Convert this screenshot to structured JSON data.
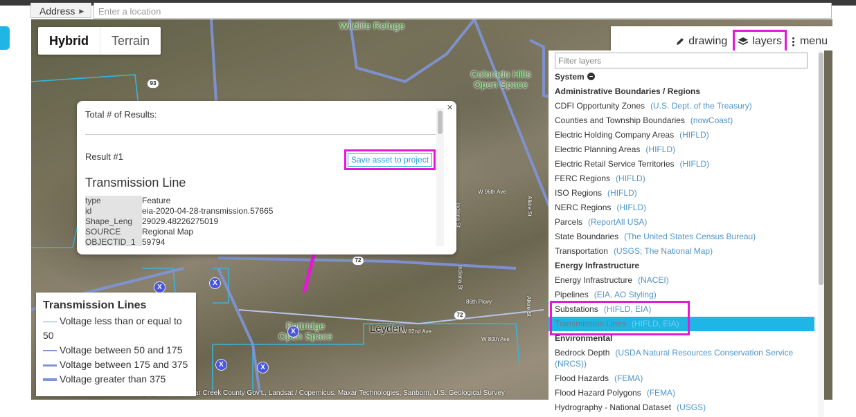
{
  "address": {
    "label": "Address",
    "placeholder": "Enter a location"
  },
  "map": {
    "type_options": [
      "Hybrid",
      "Terrain"
    ],
    "active_type": "Hybrid",
    "labels": {
      "wildlife_refuge": "Wildlife Refuge",
      "colorado_hills": "Colorado Hills Open Space",
      "pattridge": "Pattridge Open Space",
      "leyden": "Leyden"
    },
    "roads": {
      "w96": "W 96th Ave",
      "w86": "86th Pkwy",
      "w82": "W 82nd Ave",
      "w80": "W 80th Ave",
      "indiana": "Indiana St",
      "alkire": "Alkire St",
      "shield_93": "93",
      "shield_72": "72",
      "shield_72b": "72"
    },
    "attribution": "Imagery ©2020 , Clear Creek County Gov't., Landsat / Copernicus, Maxar Technologies, Sanborn, U.S. Geological Survey"
  },
  "popup": {
    "total_label": "Total # of Results:",
    "result_label": "Result #1",
    "save_button": "Save asset to project",
    "feature_title": "Transmission Line",
    "attributes": [
      {
        "key": "type",
        "value": "Feature"
      },
      {
        "key": "id",
        "value": "eia-2020-04-28-transmission.57665"
      },
      {
        "key": "Shape_Leng",
        "value": "29029.48226275019"
      },
      {
        "key": "SOURCE",
        "value": "Regional Map"
      },
      {
        "key": "OBJECTID_1",
        "value": "59794"
      }
    ],
    "close_glyph": "×"
  },
  "legend": {
    "title": "Transmission Lines",
    "items": [
      {
        "label": "Voltage less than or equal to 50",
        "weight": 1
      },
      {
        "label": "Voltage between 50 and 175",
        "weight": 2
      },
      {
        "label": "Voltage between 175 and 375",
        "weight": 3
      },
      {
        "label": "Voltage greater than 375",
        "weight": 4
      }
    ]
  },
  "toolbar": {
    "drawing": "drawing",
    "layers": "layers",
    "menu": "menu"
  },
  "layers": {
    "filter_placeholder": "Filter layers",
    "system_label": "System",
    "groups": [
      {
        "name": "Administrative Boundaries / Regions",
        "items": [
          {
            "name": "CDFI Opportunity Zones",
            "source": "(U.S. Dept. of the Treasury)"
          },
          {
            "name": "Counties and Township Boundaries",
            "source": "(nowCoast)"
          },
          {
            "name": "Electric Holding Company Areas",
            "source": "(HIFLD)"
          },
          {
            "name": "Electric Planning Areas",
            "source": "(HIFLD)"
          },
          {
            "name": "Electric Retail Service Territories",
            "source": "(HIFLD)"
          },
          {
            "name": "FERC Regions",
            "source": "(HIFLD)"
          },
          {
            "name": "ISO Regions",
            "source": "(HIFLD)"
          },
          {
            "name": "NERC Regions",
            "source": "(HIFLD)"
          },
          {
            "name": "Parcels",
            "source": "(ReportAll USA)"
          },
          {
            "name": "State Boundaries",
            "source": "(The United States Census Bureau)"
          },
          {
            "name": "Transportation",
            "source": "(USGS; The National Map)"
          }
        ]
      },
      {
        "name": "Energy Infrastructure",
        "items": [
          {
            "name": "Energy Infrastructure",
            "source": "(NACEI)"
          },
          {
            "name": "Pipelines",
            "source": "(EIA, AO Styling)"
          },
          {
            "name": "Substations",
            "source": "(HIFLD, EIA)"
          },
          {
            "name": "Transmission Lines",
            "source": "(HIFLD, EIA)",
            "selected": true
          }
        ]
      },
      {
        "name": "Environmental",
        "items": [
          {
            "name": "Bedrock Depth",
            "source": "(USDA Natural Resources Conservation Service (NRCS))"
          },
          {
            "name": "Flood Hazards",
            "source": "(FEMA)"
          },
          {
            "name": "Flood Hazard Polygons",
            "source": "(FEMA)"
          },
          {
            "name": "Hydrography - National Dataset",
            "source": "(USGS)"
          }
        ]
      }
    ]
  },
  "colors": {
    "accent": "#1fb6e6",
    "highlight": "#e816d6",
    "source_link": "#4f94c9",
    "marker": "#4a56e0",
    "line": "#7f95d9"
  },
  "icons": {
    "pencil": "pencil-icon",
    "layers": "layers-icon",
    "menu": "dots-vertical-icon",
    "caret": "caret-right-icon",
    "arrow": "annotation-arrow"
  }
}
